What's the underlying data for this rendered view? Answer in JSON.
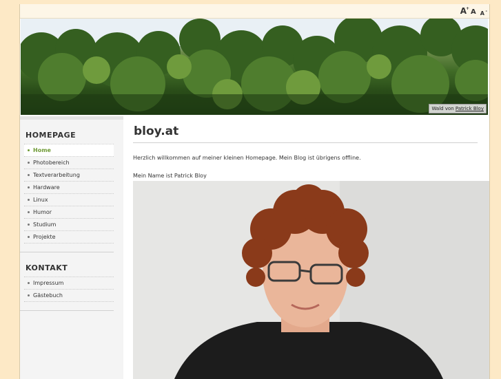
{
  "fontsize": {
    "larger": "A",
    "larger_sup": "+",
    "normal": "A",
    "smaller": "A",
    "smaller_sup": "-"
  },
  "header": {
    "credit_prefix": "Wald von",
    "credit_link": "Patrick Bloy"
  },
  "sidebar": {
    "homepage_title": "HOMEPAGE",
    "homepage_items": [
      "Home",
      "Photobereich",
      "Textverarbeitung",
      "Hardware",
      "Linux",
      "Humor",
      "Studium",
      "Projekte"
    ],
    "active_item": "Home",
    "kontakt_title": "KONTAKT",
    "kontakt_items": [
      "Impressum",
      "Gästebuch"
    ]
  },
  "main": {
    "title": "bloy.at",
    "intro": "Herzlich willkommen auf meiner kleinen Homepage. Mein Blog ist übrigens offline.",
    "name_line": "Mein Name ist Patrick Bloy"
  },
  "colors": {
    "background": "#fde9c6",
    "accent_green": "#6f9a35"
  }
}
